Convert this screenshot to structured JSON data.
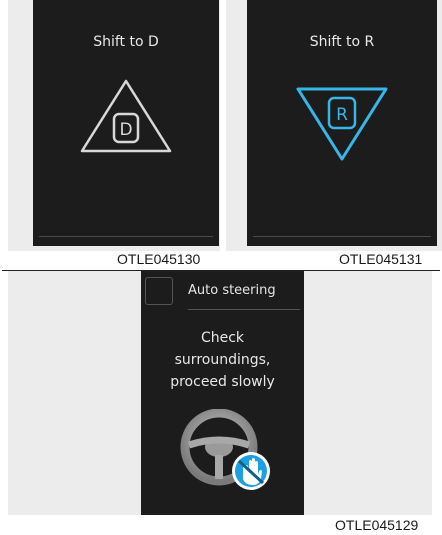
{
  "panel_d": {
    "title": "Shift to D",
    "icon_letter": "D",
    "caption": "OTLE045130",
    "icon_color": "#d8d8d8"
  },
  "panel_r": {
    "title": "Shift to R",
    "icon_letter": "R",
    "caption": "OTLE045131",
    "icon_color": "#38b6e8"
  },
  "panel_auto": {
    "auto_label": "Auto steering",
    "message_lines": [
      "Check",
      "surroundings,",
      "proceed slowly"
    ],
    "caption": "OTLE045129",
    "hand_badge_color": "#1e9fe0"
  }
}
